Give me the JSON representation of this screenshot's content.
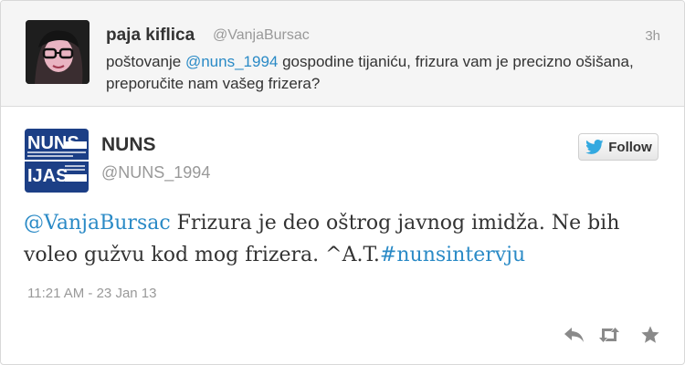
{
  "context_tweet": {
    "display_name": "paja kiflica",
    "handle": "@VanjaBursac",
    "time": "3h",
    "text_prefix": "poštovanje ",
    "mention": "@nuns_1994",
    "text_rest": " gospodine tijaniću, frizura vam je precizno ošišana, preporučite nam vašeg frizera?"
  },
  "main_tweet": {
    "display_name": "NUNS",
    "handle": "@NUNS_1994",
    "follow_label": "Follow",
    "mention": "@VanjaBursac",
    "text_middle": " Frizura je deo oštrog javnog imidža. Ne bih voleo gužvu kod mog frizera. ^A.T.",
    "hashtag": "#nunsintervju",
    "timestamp": "11:21 AM - 23 Jan 13"
  },
  "avatar_logo": {
    "top_text": "NUNS",
    "bottom_text": "IJAS"
  },
  "icons": {
    "follow": "twitter-bird-icon",
    "reply": "reply-icon",
    "retweet": "retweet-icon",
    "favorite": "star-icon"
  },
  "colors": {
    "link": "#2a8ac6",
    "twitter_blue": "#33a9e0",
    "nuns_blue": "#1c3f86",
    "action_gray": "#8a8a8a"
  }
}
